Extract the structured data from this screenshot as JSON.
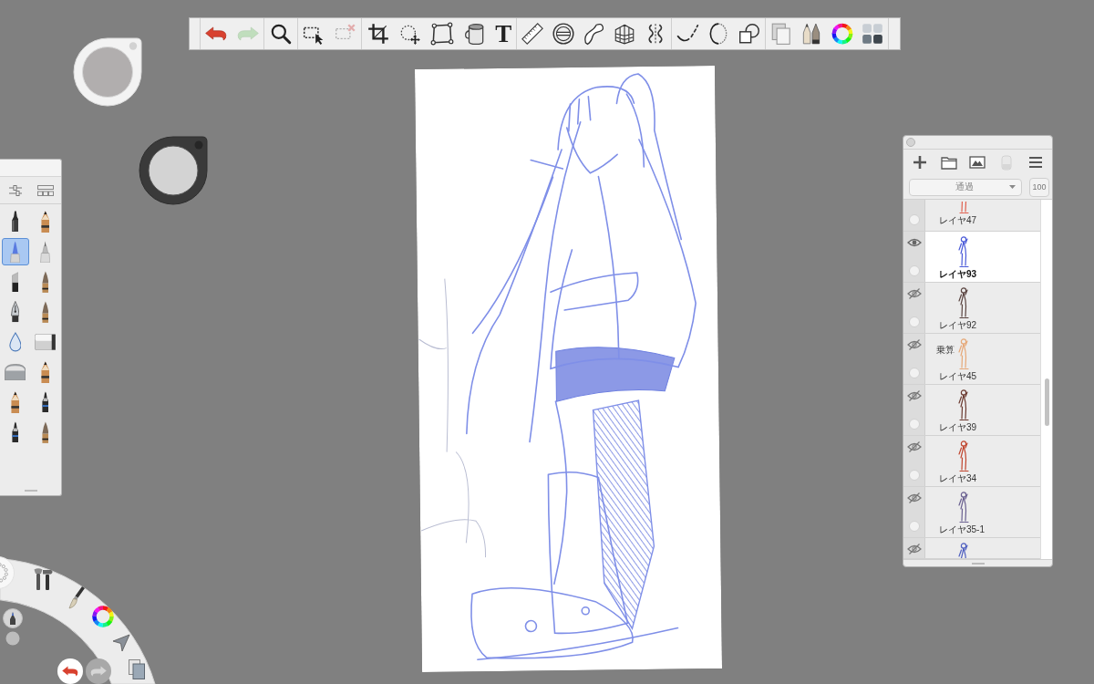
{
  "toolbar": {
    "groups": [
      [
        {
          "kind": "undo",
          "disabled": false
        },
        {
          "kind": "redo",
          "disabled": true
        }
      ],
      [
        {
          "kind": "zoom",
          "disabled": false
        }
      ],
      [
        {
          "kind": "select",
          "disabled": false
        },
        {
          "kind": "deselect",
          "disabled": true
        }
      ],
      [
        {
          "kind": "crop",
          "disabled": false
        },
        {
          "kind": "transform",
          "disabled": false
        },
        {
          "kind": "distort",
          "disabled": false
        },
        {
          "kind": "fill",
          "disabled": false
        },
        {
          "kind": "text",
          "label": "T",
          "disabled": false
        }
      ],
      [
        {
          "kind": "ruler",
          "disabled": false
        },
        {
          "kind": "ellipse",
          "disabled": false
        },
        {
          "kind": "curve",
          "disabled": false
        },
        {
          "kind": "perspective",
          "disabled": false
        },
        {
          "kind": "symmetry",
          "disabled": false
        }
      ],
      [
        {
          "kind": "steady",
          "disabled": false
        },
        {
          "kind": "predictive",
          "disabled": false
        },
        {
          "kind": "shapes",
          "disabled": false
        }
      ],
      [
        {
          "kind": "copy",
          "disabled": false
        },
        {
          "kind": "brushes",
          "disabled": false
        },
        {
          "kind": "color",
          "disabled": false
        },
        {
          "kind": "library",
          "disabled": false
        }
      ]
    ]
  },
  "brush_palette": {
    "brushes": [
      {
        "kind": "felt",
        "selected": false
      },
      {
        "kind": "pencil",
        "selected": false
      },
      {
        "kind": "ballpoint",
        "selected": true
      },
      {
        "kind": "technical",
        "selected": false
      },
      {
        "kind": "chisel",
        "selected": false
      },
      {
        "kind": "brush",
        "selected": false
      },
      {
        "kind": "nib",
        "selected": false
      },
      {
        "kind": "brush",
        "selected": false
      },
      {
        "kind": "drop",
        "selected": false
      },
      {
        "kind": "eraser",
        "selected": false
      },
      {
        "kind": "softeraser",
        "selected": false
      },
      {
        "kind": "pencil",
        "selected": false
      },
      {
        "kind": "pencil",
        "selected": false
      },
      {
        "kind": "pen",
        "selected": false
      },
      {
        "kind": "pen",
        "selected": false
      },
      {
        "kind": "brush",
        "selected": false
      }
    ]
  },
  "layers": {
    "tools": [
      {
        "kind": "add",
        "disabled": false
      },
      {
        "kind": "folder",
        "disabled": false
      },
      {
        "kind": "image",
        "disabled": false
      },
      {
        "kind": "clear",
        "disabled": true
      },
      {
        "kind": "menu",
        "disabled": false
      }
    ],
    "blend_mode": "通過",
    "opacity": "100",
    "items": [
      {
        "name": "レイヤ47",
        "selected": false,
        "color": "#e0604f"
      },
      {
        "name": "レイヤ93",
        "visible": true,
        "selected": true,
        "color": "#4a5ad8"
      },
      {
        "name": "レイヤ92",
        "visible": false,
        "selected": false,
        "color": "#5a4440"
      },
      {
        "name": "レイヤ45",
        "blend": "乗算",
        "visible": false,
        "selected": false,
        "color": "#e6a878"
      },
      {
        "name": "レイヤ39",
        "visible": false,
        "selected": false,
        "color": "#6b3a30"
      },
      {
        "name": "レイヤ34",
        "visible": false,
        "selected": false,
        "color": "#c0452e"
      },
      {
        "name": "レイヤ35-1",
        "visible": false,
        "selected": false,
        "color": "#6a6090"
      },
      {
        "visible": false,
        "selected": false,
        "color": "#5060c0"
      }
    ]
  },
  "radial_menu": {
    "undo": {
      "disabled": false
    },
    "redo": {
      "disabled": true
    }
  }
}
